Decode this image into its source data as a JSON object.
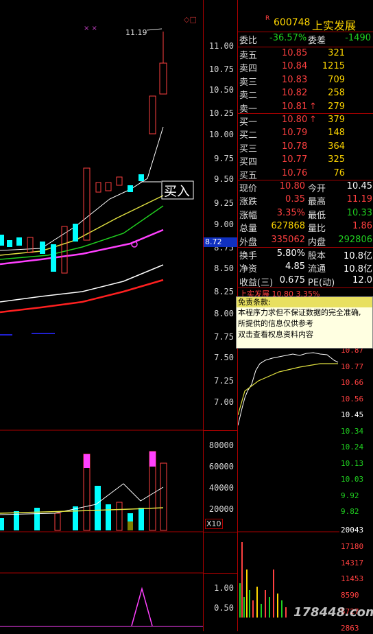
{
  "stock": {
    "badge": "R",
    "code": "600748",
    "name": "上实发展"
  },
  "left_axis": {
    "ticks": [
      "11.00",
      "10.75",
      "10.50",
      "10.25",
      "10.00",
      "9.75",
      "9.50",
      "9.25",
      "9.00",
      "8.75",
      "8.50",
      "8.25",
      "8.00",
      "7.75",
      "7.50",
      "7.25",
      "7.00"
    ],
    "cursor_price": "8.72",
    "high_label": "11.19",
    "buy_signal": "买入",
    "vol_ticks": [
      "80000",
      "60000",
      "40000",
      "20000"
    ],
    "vol_unit": "X10",
    "ind_ticks": [
      "1.00",
      "0.50"
    ]
  },
  "quote": {
    "weibi_label": "委比",
    "weibi": "-36.57%",
    "weicha_label": "委差",
    "weicha": "-1490",
    "sells": [
      {
        "label": "卖五",
        "price": "10.85",
        "vol": "321"
      },
      {
        "label": "卖四",
        "price": "10.84",
        "vol": "1215"
      },
      {
        "label": "卖三",
        "price": "10.83",
        "vol": "709"
      },
      {
        "label": "卖二",
        "price": "10.82",
        "vol": "258"
      },
      {
        "label": "卖一",
        "price": "10.81",
        "vol": "279",
        "arrow": "↑"
      }
    ],
    "buys": [
      {
        "label": "买一",
        "price": "10.80",
        "vol": "379",
        "arrow": "↑"
      },
      {
        "label": "买二",
        "price": "10.79",
        "vol": "148"
      },
      {
        "label": "买三",
        "price": "10.78",
        "vol": "364"
      },
      {
        "label": "买四",
        "price": "10.77",
        "vol": "325"
      },
      {
        "label": "买五",
        "price": "10.76",
        "vol": "76"
      }
    ],
    "stats": [
      {
        "l1": "现价",
        "v1": "10.80",
        "c1": "up",
        "l2": "今开",
        "v2": "10.45",
        "c2": "wh"
      },
      {
        "l1": "涨跌",
        "v1": "0.35",
        "c1": "up",
        "l2": "最高",
        "v2": "11.19",
        "c2": "up"
      },
      {
        "l1": "涨幅",
        "v1": "3.35%",
        "c1": "up",
        "l2": "最低",
        "v2": "10.33",
        "c2": "gr"
      },
      {
        "l1": "总量",
        "v1": "627868",
        "c1": "ye",
        "l2": "量比",
        "v2": "1.86",
        "c2": "up"
      },
      {
        "l1": "外盘",
        "v1": "335062",
        "c1": "up",
        "l2": "内盘",
        "v2": "292806",
        "c2": "gr"
      }
    ],
    "fin": [
      {
        "l1": "换手",
        "v1": "5.80%",
        "l2": "股本",
        "v2": "10.8亿"
      },
      {
        "l1": "净资",
        "v1": "4.85",
        "l2": "流通",
        "v2": "10.8亿"
      },
      {
        "l1": "收益(三)",
        "v1": "0.675",
        "l2": "PE(动)",
        "v2": "12.0"
      }
    ]
  },
  "notice": {
    "title": "免责条款:",
    "under_text": "上实发展  10.80  3.35%",
    "lines": [
      "本程序力求但不保证数据的完全准确,",
      "所提供的信息仅供参考",
      "双击查看权息资料内容"
    ]
  },
  "intraday_axis": [
    "10.87",
    "10.77",
    "10.66",
    "10.56",
    "10.45",
    "10.34",
    "10.24",
    "10.13",
    "10.03",
    "9.92",
    "9.82"
  ],
  "intraday_vol_axis": [
    "20043",
    "17180",
    "14317",
    "11453",
    "8590",
    "5727",
    "2863"
  ],
  "watermark": "178448.com"
}
